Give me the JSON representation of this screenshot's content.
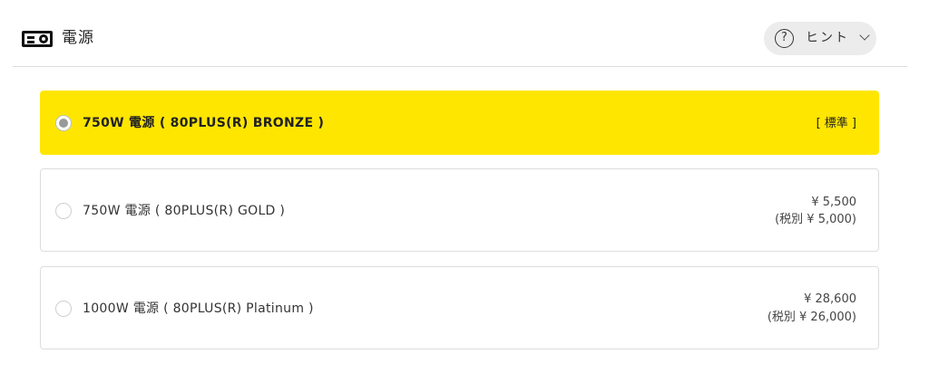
{
  "section": {
    "icon": "power-supply-icon",
    "title": "電源"
  },
  "hint": {
    "icon": "question-circle-icon",
    "label": "ヒント",
    "chevron": "chevron-down-icon"
  },
  "options": [
    {
      "label": "750W 電源 ( 80PLUS(R) BRONZE )",
      "tag": "[ 標準 ]",
      "price": "",
      "price_excl": "",
      "selected": true
    },
    {
      "label": "750W 電源 ( 80PLUS(R) GOLD )",
      "tag": "",
      "price": "¥ 5,500",
      "price_excl": "(税別 ¥ 5,000)",
      "selected": false
    },
    {
      "label": "1000W 電源 ( 80PLUS(R) Platinum )",
      "tag": "",
      "price": "¥ 28,600",
      "price_excl": "(税別 ¥ 26,000)",
      "selected": false
    }
  ],
  "colors": {
    "selected_bg": "#ffe600",
    "hint_bg": "#ececec",
    "border": "#dddddd"
  }
}
